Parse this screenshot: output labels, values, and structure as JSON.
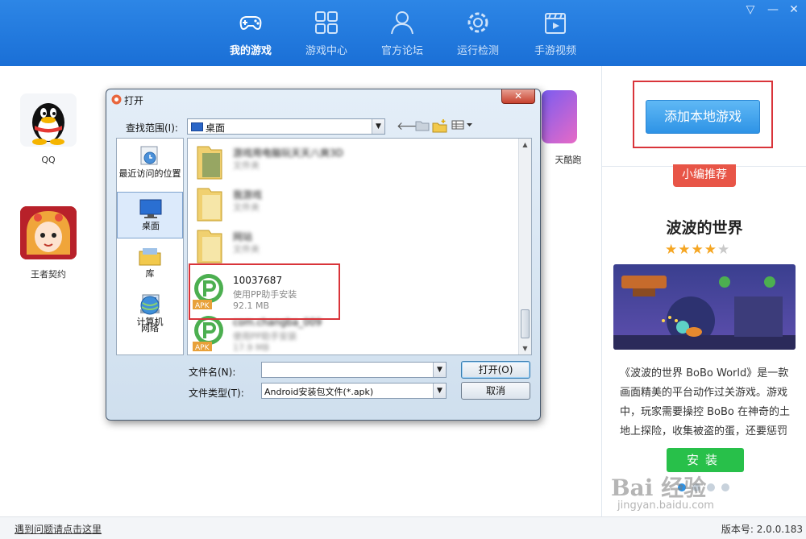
{
  "nav": {
    "items": [
      {
        "label": "我的游戏",
        "icon": "gamepad-icon",
        "active": true
      },
      {
        "label": "游戏中心",
        "icon": "grid-icon",
        "active": false
      },
      {
        "label": "官方论坛",
        "icon": "user-icon",
        "active": false
      },
      {
        "label": "运行检测",
        "icon": "gear-icon",
        "active": false
      },
      {
        "label": "手游视频",
        "icon": "film-icon",
        "active": false
      }
    ]
  },
  "games": [
    {
      "name": "QQ"
    },
    {
      "name": "天酷跑"
    },
    {
      "name": "王者契约"
    }
  ],
  "right_panel": {
    "add_button": "添加本地游戏",
    "recommend_tag": "小编推荐",
    "title": "波波的世界",
    "rating": 3.5,
    "rating_max": 5,
    "desc_lines": [
      "《波波的世界 BoBo World》是一款",
      "画面精美的平台动作过关游戏。游戏",
      "中，玩家需要操控 BoBo 在神奇的土",
      "地上探险，收集被盗的蛋，还要惩罚"
    ],
    "install_button": "安装"
  },
  "dialog": {
    "title": "打开",
    "close": "✕",
    "look_in_label": "查找范围(I):",
    "look_in_value": "桌面",
    "places": [
      {
        "label": "最近访问的位置",
        "icon": "recent-icon"
      },
      {
        "label": "桌面",
        "icon": "desktop-icon"
      },
      {
        "label": "库",
        "icon": "library-icon"
      },
      {
        "label": "计算机",
        "icon": "computer-icon"
      },
      {
        "label": "网络",
        "icon": "network-icon"
      }
    ],
    "files": [
      {
        "name": "游戏用电脑玩天天八爽3D",
        "type": "文件夹",
        "size": "",
        "kind": "folder",
        "blurred": true
      },
      {
        "name": "我游戏",
        "type": "文件夹",
        "size": "",
        "kind": "folder",
        "blurred": true
      },
      {
        "name": "网站",
        "type": "文件夹",
        "size": "",
        "kind": "folder",
        "blurred": true
      },
      {
        "name": "10037687",
        "type": "使用PP助手安装",
        "size": "92.1 MB",
        "kind": "apk",
        "blurred": false
      },
      {
        "name": "com.changba_009",
        "type": "使用PP助手安装",
        "size": "17.9 MB",
        "kind": "apk",
        "blurred": true
      }
    ],
    "filename_label": "文件名(N):",
    "filename_value": "",
    "filetype_label": "文件类型(T):",
    "filetype_value": "Android安装包文件(*.apk)",
    "open_button": "打开(O)",
    "cancel_button": "取消",
    "apk_badge": "APK"
  },
  "status": {
    "help_link": "遇到问题请点击这里",
    "version": "版本号: 2.0.0.183"
  },
  "watermark": {
    "brand": "Bai 经验",
    "url": "jingyan.baidu.com"
  },
  "colors": {
    "topbar": "#1a6fd6",
    "highlight": "#d9343a",
    "install": "#28c04a",
    "recommend": "#e85547"
  }
}
